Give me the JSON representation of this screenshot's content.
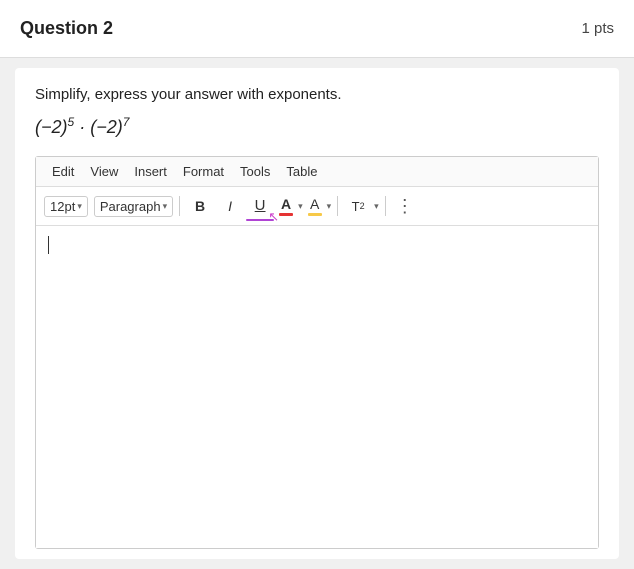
{
  "header": {
    "question_title": "Question 2",
    "points": "1 pts"
  },
  "question": {
    "instruction": "Simplify, express your answer with exponents.",
    "math_prefix": "(",
    "math_base1": "−2",
    "math_suffix1": ")",
    "math_exp1": "5",
    "math_dot": " · ",
    "math_prefix2": "(",
    "math_base2": "−2",
    "math_suffix2": ")",
    "math_exp2": "7"
  },
  "menu": {
    "edit": "Edit",
    "view": "View",
    "insert": "Insert",
    "format": "Format",
    "tools": "Tools",
    "table": "Table"
  },
  "toolbar": {
    "font_size": "12pt",
    "paragraph": "Paragraph",
    "bold": "B",
    "italic": "I",
    "underline": "U",
    "font_color_label": "A",
    "highlight_label": "A",
    "superscript_label": "T²",
    "more": "⋮"
  },
  "editor": {
    "placeholder": ""
  },
  "colors": {
    "underline_bar": "#b044d4",
    "font_color_bar": "#e53333",
    "highlight_bar": "#f7c948"
  }
}
